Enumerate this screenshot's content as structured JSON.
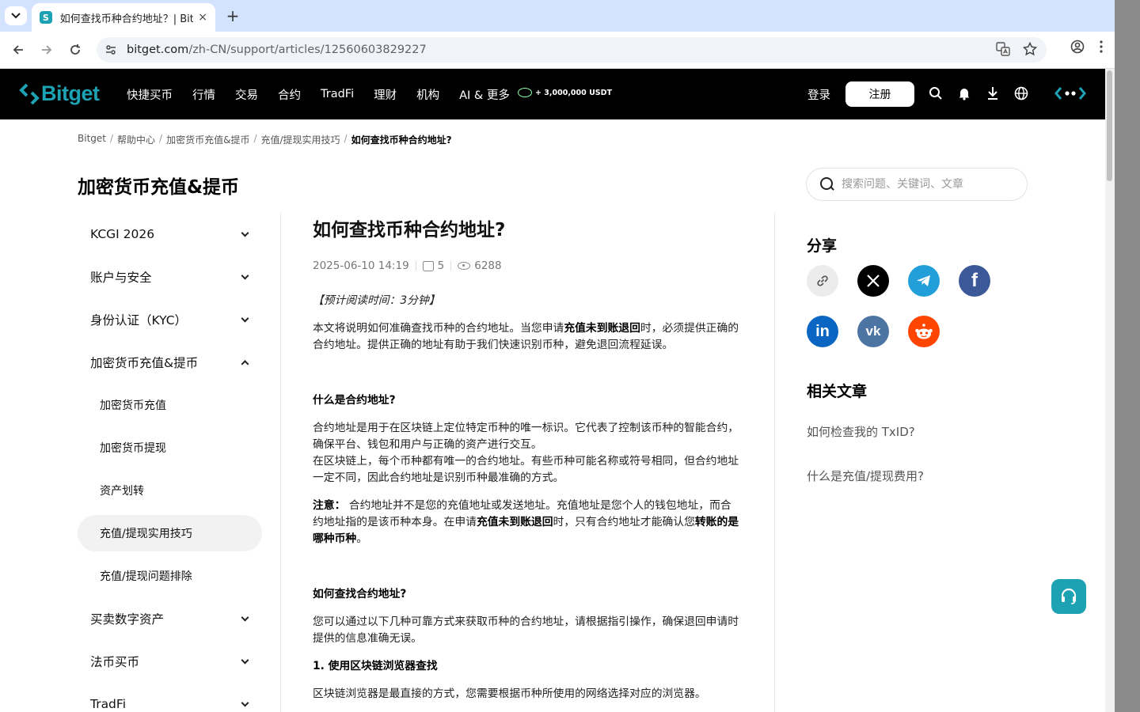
{
  "browser": {
    "tab_title": "如何查找币种合约地址？| Bitget",
    "tab_close": "×",
    "new_tab": "+",
    "url_domain": "bitget.com",
    "url_path": "/zh-CN/support/articles/12560603829227"
  },
  "header": {
    "logo": "Bitget",
    "nav": [
      "快捷买币",
      "行情",
      "交易",
      "合约",
      "TradFi",
      "理财",
      "机构",
      "AI & 更多"
    ],
    "promo": "+ 3,000,000 USDT",
    "login": "登录",
    "register": "注册"
  },
  "breadcrumb": {
    "items": [
      "Bitget",
      "帮助中心",
      "加密货币充值&提币",
      "充值/提现实用技巧"
    ],
    "current": "如何查找币种合约地址?",
    "separator": "/"
  },
  "category_title": "加密货币充值&提币",
  "search": {
    "placeholder": "搜索问题、关键词、文章"
  },
  "sidebar": {
    "items_top": [
      "KCGI 2026",
      "账户与安全",
      "身份认证（KYC）"
    ],
    "expanded": "加密货币充值&提币",
    "sub_items": [
      "加密货币充值",
      "加密货币提现",
      "资产划转",
      "充值/提现实用技巧",
      "充值/提现问题排除"
    ],
    "active_sub": "充值/提现实用技巧",
    "items_bottom": [
      "买卖数字资产",
      "法币买币",
      "TradFi"
    ]
  },
  "article": {
    "title": "如何查找币种合约地址?",
    "date": "2025-06-10 14:19",
    "likes": "5",
    "views": "6288",
    "reading_time": "【预计阅读时间：3分钟】",
    "intro_a": "本文将说明如何准确查找币种的合约地址。当您申请",
    "intro_b": "充值未到账退回",
    "intro_c": "时，必须提供正确的合约地址。提供正确的地址有助于我们快速识别币种，避免退回流程延误。",
    "h1": "什么是合约地址?",
    "p1": "合约地址是用于在区块链上定位特定币种的唯一标识。它代表了控制该币种的智能合约，确保平台、钱包和用户与正确的资产进行交互。",
    "p2": "在区块链上，每个币种都有唯一的合约地址。有些币种可能名称或符号相同，但合约地址一定不同，因此合约地址是识别币种最准确的方式。",
    "note_label": "注意：",
    "note_a": " 合约地址并不是您的充值地址或发送地址。充值地址是您个人的钱包地址，而合约地址指的是该币种本身。在申请",
    "note_b": "充值未到账退回",
    "note_c": "时，只有合约地址才能确认您",
    "note_d": "转账的是哪种币种",
    "note_e": "。",
    "h2": "如何查找合约地址?",
    "p3": "您可以通过以下几种可靠方式来获取币种的合约地址，请根据指引操作，确保退回申请时提供的信息准确无误。",
    "h3": "1. 使用区块链浏览器查找",
    "p4": "区块链浏览器是最直接的方式，您需要根据币种所使用的网络选择对应的浏览器。"
  },
  "share": {
    "title": "分享",
    "icons": [
      {
        "name": "link-icon",
        "glyph": "🔗",
        "color": "#ececec"
      },
      {
        "name": "x-icon",
        "glyph": "𝕏",
        "color": "#000000"
      },
      {
        "name": "telegram-icon",
        "glyph": "➤",
        "color": "#229ed9"
      },
      {
        "name": "facebook-icon",
        "glyph": "f",
        "color": "#3b5998"
      },
      {
        "name": "linkedin-icon",
        "glyph": "in",
        "color": "#0a66c2"
      },
      {
        "name": "vk-icon",
        "glyph": "vk",
        "color": "#4c75a3"
      },
      {
        "name": "reddit-icon",
        "glyph": "●",
        "color": "#ff4500"
      }
    ]
  },
  "related": {
    "title": "相关文章",
    "items": [
      "如何检查我的 TxID?",
      "什么是充值/提现费用?"
    ]
  },
  "colors": {
    "brand": "#1da2b4"
  }
}
